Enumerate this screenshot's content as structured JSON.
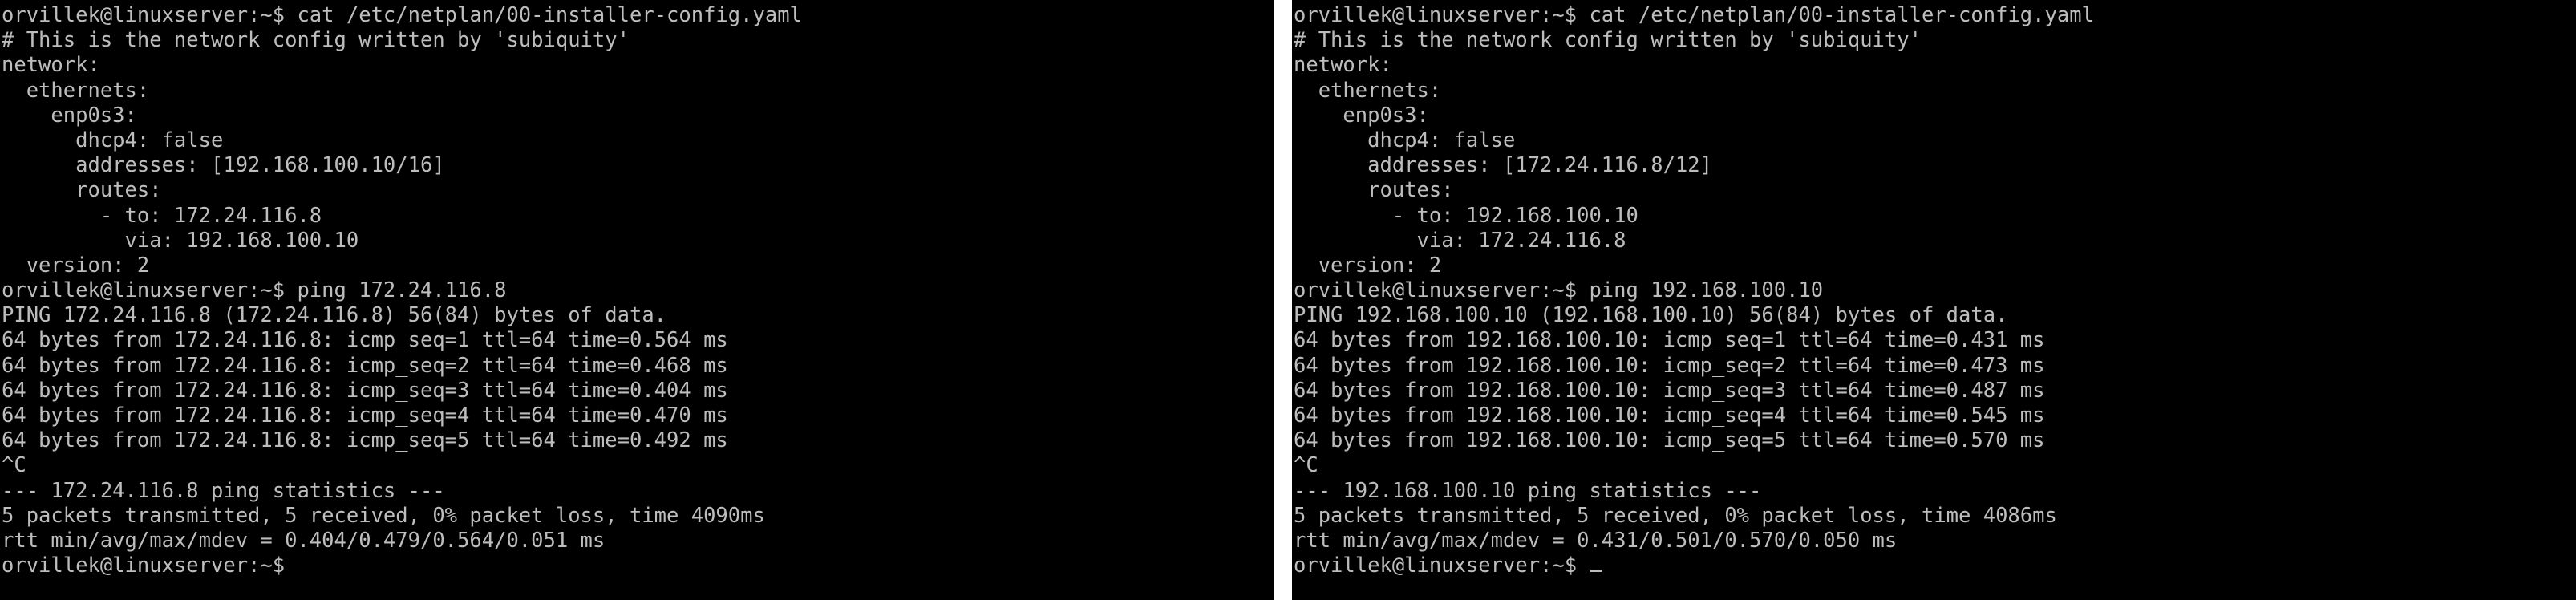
{
  "colors": {
    "terminal_background": "#000000",
    "terminal_text": "#bdbdbd",
    "divider": "#ffffff"
  },
  "left_terminal": {
    "lines": [
      "orvillek@linuxserver:~$ cat /etc/netplan/00-installer-config.yaml",
      "# This is the network config written by 'subiquity'",
      "network:",
      "  ethernets:",
      "    enp0s3:",
      "      dhcp4: false",
      "      addresses: [192.168.100.10/16]",
      "      routes:",
      "        - to: 172.24.116.8",
      "          via: 192.168.100.10",
      "  version: 2",
      "orvillek@linuxserver:~$ ping 172.24.116.8",
      "PING 172.24.116.8 (172.24.116.8) 56(84) bytes of data.",
      "64 bytes from 172.24.116.8: icmp_seq=1 ttl=64 time=0.564 ms",
      "64 bytes from 172.24.116.8: icmp_seq=2 ttl=64 time=0.468 ms",
      "64 bytes from 172.24.116.8: icmp_seq=3 ttl=64 time=0.404 ms",
      "64 bytes from 172.24.116.8: icmp_seq=4 ttl=64 time=0.470 ms",
      "64 bytes from 172.24.116.8: icmp_seq=5 ttl=64 time=0.492 ms",
      "^C",
      "--- 172.24.116.8 ping statistics ---",
      "5 packets transmitted, 5 received, 0% packet loss, time 4090ms",
      "rtt min/avg/max/mdev = 0.404/0.479/0.564/0.051 ms",
      "orvillek@linuxserver:~$"
    ]
  },
  "right_terminal": {
    "lines": [
      "orvillek@linuxserver:~$ cat /etc/netplan/00-installer-config.yaml",
      "# This is the network config written by 'subiquity'",
      "network:",
      "  ethernets:",
      "    enp0s3:",
      "      dhcp4: false",
      "      addresses: [172.24.116.8/12]",
      "      routes:",
      "        - to: 192.168.100.10",
      "          via: 172.24.116.8",
      "  version: 2",
      "orvillek@linuxserver:~$ ping 192.168.100.10",
      "PING 192.168.100.10 (192.168.100.10) 56(84) bytes of data.",
      "64 bytes from 192.168.100.10: icmp_seq=1 ttl=64 time=0.431 ms",
      "64 bytes from 192.168.100.10: icmp_seq=2 ttl=64 time=0.473 ms",
      "64 bytes from 192.168.100.10: icmp_seq=3 ttl=64 time=0.487 ms",
      "64 bytes from 192.168.100.10: icmp_seq=4 ttl=64 time=0.545 ms",
      "64 bytes from 192.168.100.10: icmp_seq=5 ttl=64 time=0.570 ms",
      "^C",
      "--- 192.168.100.10 ping statistics ---",
      "5 packets transmitted, 5 received, 0% packet loss, time 4086ms",
      "rtt min/avg/max/mdev = 0.431/0.501/0.570/0.050 ms",
      "orvillek@linuxserver:~$ "
    ]
  }
}
